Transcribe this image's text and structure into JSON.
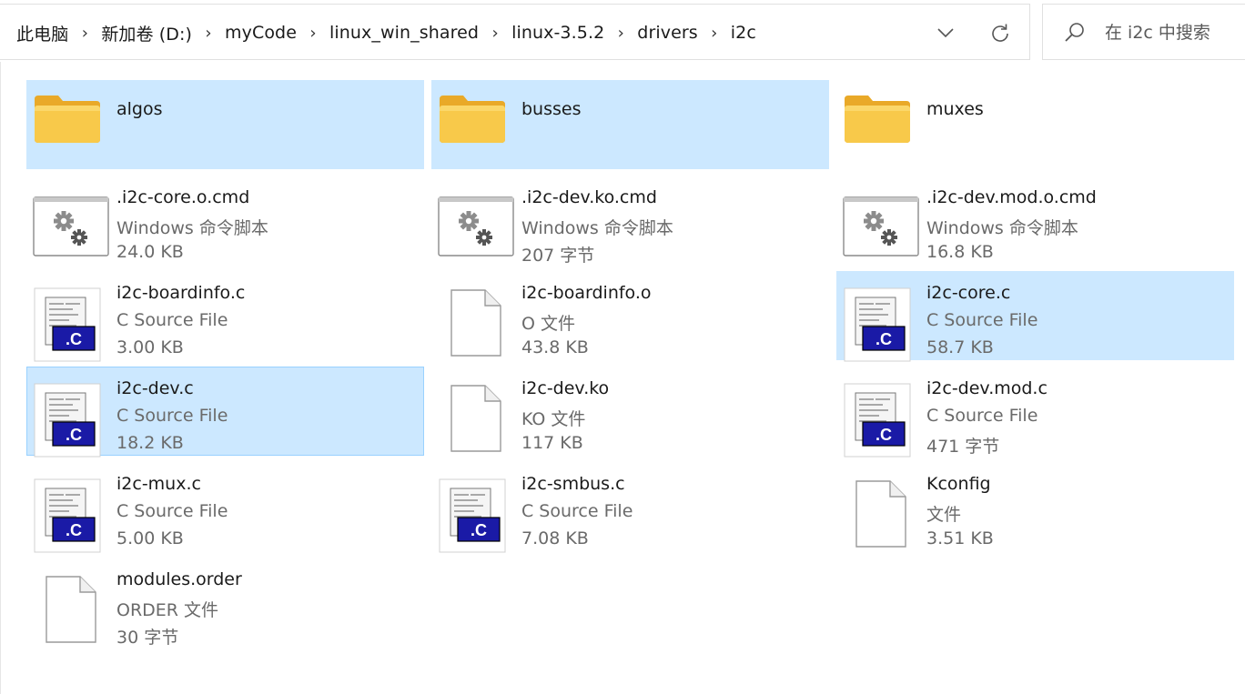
{
  "breadcrumb": [
    "此电脑",
    "新加卷 (D:)",
    "myCode",
    "linux_win_shared",
    "linux-3.5.2",
    "drivers",
    "i2c"
  ],
  "search": {
    "placeholder": "在 i2c 中搜索"
  },
  "colors": {
    "selection_bg": "#cce8ff",
    "selection_border": "#99d1ff",
    "folder": "#f8c94a",
    "c_badge": "#1a1aa6"
  },
  "items": [
    {
      "name": "algos",
      "kind": "folder",
      "icon": "folder-icon",
      "selected": true,
      "focused": false
    },
    {
      "name": "busses",
      "kind": "folder",
      "icon": "folder-icon",
      "selected": true,
      "focused": false
    },
    {
      "name": "muxes",
      "kind": "folder",
      "icon": "folder-icon",
      "selected": false,
      "focused": false
    },
    {
      "name": ".i2c-core.o.cmd",
      "type": "Windows 命令脚本",
      "size": "24.0 KB",
      "kind": "cmd",
      "icon": "script-gear-icon",
      "selected": false,
      "focused": false
    },
    {
      "name": ".i2c-dev.ko.cmd",
      "type": "Windows 命令脚本",
      "size": "207 字节",
      "kind": "cmd",
      "icon": "script-gear-icon",
      "selected": false,
      "focused": false
    },
    {
      "name": ".i2c-dev.mod.o.cmd",
      "type": "Windows 命令脚本",
      "size": "16.8 KB",
      "kind": "cmd",
      "icon": "script-gear-icon",
      "selected": false,
      "focused": false
    },
    {
      "name": "i2c-boardinfo.c",
      "type": "C Source File",
      "size": "3.00 KB",
      "kind": "csrc",
      "icon": "c-source-icon",
      "selected": false,
      "focused": false
    },
    {
      "name": "i2c-boardinfo.o",
      "type": "O 文件",
      "size": "43.8 KB",
      "kind": "blank",
      "icon": "blank-file-icon",
      "selected": false,
      "focused": false
    },
    {
      "name": "i2c-core.c",
      "type": "C Source File",
      "size": "58.7 KB",
      "kind": "csrc",
      "icon": "c-source-icon",
      "selected": true,
      "focused": false
    },
    {
      "name": "i2c-dev.c",
      "type": "C Source File",
      "size": "18.2 KB",
      "kind": "csrc",
      "icon": "c-source-icon",
      "selected": true,
      "focused": true
    },
    {
      "name": "i2c-dev.ko",
      "type": "KO 文件",
      "size": "117 KB",
      "kind": "blank",
      "icon": "blank-file-icon",
      "selected": false,
      "focused": false
    },
    {
      "name": "i2c-dev.mod.c",
      "type": "C Source File",
      "size": "471 字节",
      "kind": "csrc",
      "icon": "c-source-icon",
      "selected": false,
      "focused": false
    },
    {
      "name": "i2c-mux.c",
      "type": "C Source File",
      "size": "5.00 KB",
      "kind": "csrc",
      "icon": "c-source-icon",
      "selected": false,
      "focused": false
    },
    {
      "name": "i2c-smbus.c",
      "type": "C Source File",
      "size": "7.08 KB",
      "kind": "csrc",
      "icon": "c-source-icon",
      "selected": false,
      "focused": false
    },
    {
      "name": "Kconfig",
      "type": "文件",
      "size": "3.51 KB",
      "kind": "blank",
      "icon": "blank-file-icon",
      "selected": false,
      "focused": false
    },
    {
      "name": "modules.order",
      "type": "ORDER 文件",
      "size": "30 字节",
      "kind": "blank",
      "icon": "blank-file-icon",
      "selected": false,
      "focused": false
    }
  ]
}
